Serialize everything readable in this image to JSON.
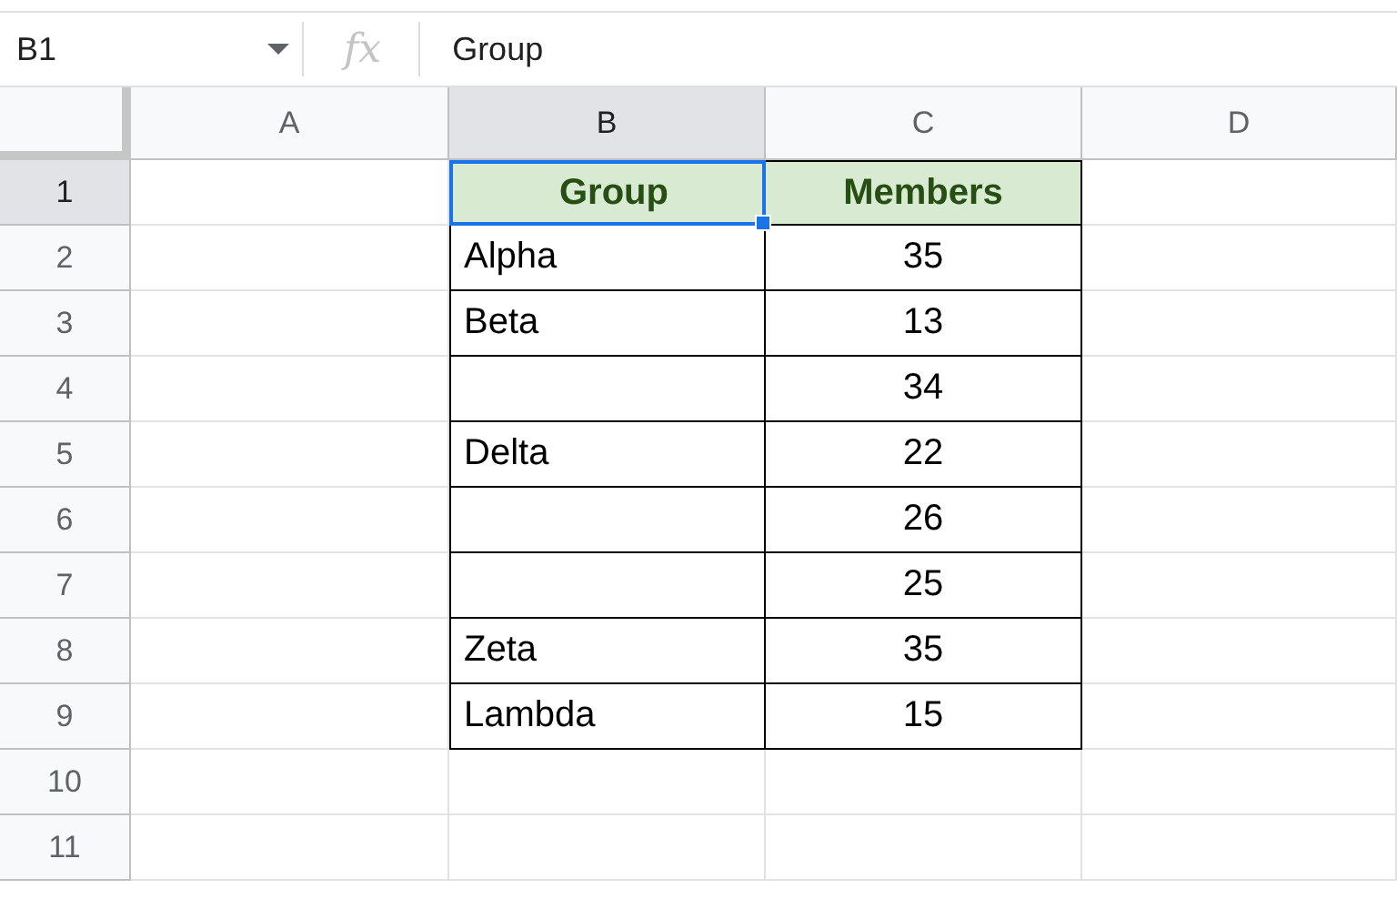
{
  "name_box": {
    "value": "B1"
  },
  "formula_bar": {
    "fx": "fx",
    "value": "Group"
  },
  "columns": [
    {
      "label": "A",
      "selected": false
    },
    {
      "label": "B",
      "selected": true
    },
    {
      "label": "C",
      "selected": false
    },
    {
      "label": "D",
      "selected": false
    }
  ],
  "rows": [
    {
      "label": "1",
      "selected": true,
      "kind": "header",
      "cells": [
        {
          "text": "Group",
          "active": true
        },
        {
          "text": "Members",
          "active": false
        }
      ]
    },
    {
      "label": "2",
      "selected": false,
      "kind": "data",
      "cells": [
        {
          "text": "Alpha",
          "active": false
        },
        {
          "text": "35",
          "active": false
        }
      ]
    },
    {
      "label": "3",
      "selected": false,
      "kind": "data",
      "cells": [
        {
          "text": "Beta",
          "active": false
        },
        {
          "text": "13",
          "active": false
        }
      ]
    },
    {
      "label": "4",
      "selected": false,
      "kind": "data",
      "cells": [
        {
          "active": false
        },
        {
          "text": "34",
          "active": false
        }
      ]
    },
    {
      "label": "5",
      "selected": false,
      "kind": "data",
      "cells": [
        {
          "text": "Delta",
          "active": false
        },
        {
          "text": "22",
          "active": false
        }
      ]
    },
    {
      "label": "6",
      "selected": false,
      "kind": "data",
      "cells": [
        {
          "active": false
        },
        {
          "text": "26",
          "active": false
        }
      ]
    },
    {
      "label": "7",
      "selected": false,
      "kind": "data",
      "cells": [
        {
          "active": false
        },
        {
          "text": "25",
          "active": false
        }
      ]
    },
    {
      "label": "8",
      "selected": false,
      "kind": "data",
      "cells": [
        {
          "text": "Zeta",
          "active": false
        },
        {
          "text": "35",
          "active": false
        }
      ]
    },
    {
      "label": "9",
      "selected": false,
      "kind": "data",
      "cells": [
        {
          "text": "Lambda",
          "active": false
        },
        {
          "text": "15",
          "active": false
        }
      ]
    },
    {
      "label": "10",
      "selected": false,
      "kind": "empty"
    },
    {
      "label": "11",
      "selected": false,
      "kind": "empty"
    }
  ]
}
